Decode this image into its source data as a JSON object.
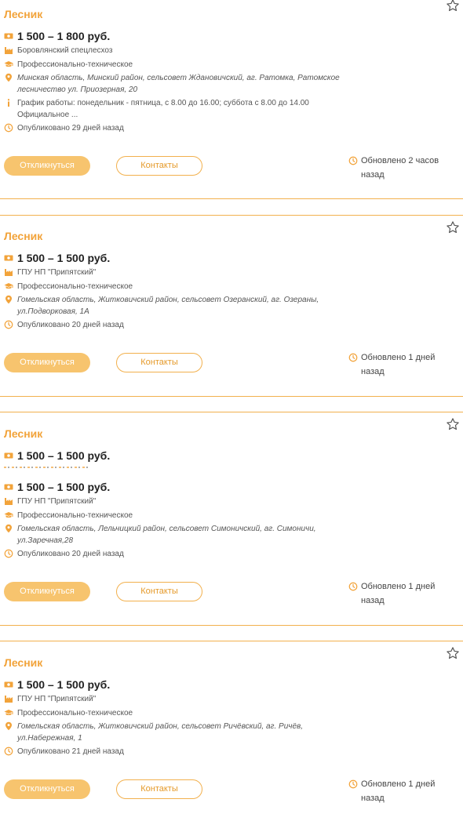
{
  "jobs": [
    {
      "title": "Лесник",
      "salary": "1 500 – 1 800 руб.",
      "employer": "Боровлянский спецлесхоз",
      "education": "Профессионально-техническое",
      "address": "Минская область, Минский район, сельсовет Ждановичский, аг. Ратомка, Ратомское\nлесничество ул. Приозерная, 20",
      "schedule": "График работы: понедельник - пятница, с 8.00 до 16.00; суббота с 8.00 до 14.00\nОфициальное ...",
      "published": "Опубликовано 29 дней назад",
      "respond_label": "Откликнуться",
      "contacts_label": "Контакты",
      "updated": "Обновлено 2 часов назад"
    },
    {
      "title": "Лесник",
      "salary": "1 500 – 1 500 руб.",
      "employer": "ГПУ НП \"Припятский\"",
      "education": "Профессионально-техническое",
      "address": "Гомельская область, Житковичский район, сельсовет Озеранский, аг. Озераны,\nул.Подворковая, 1А",
      "published": "Опубликовано 20 дней назад",
      "respond_label": "Откликнуться",
      "contacts_label": "Контакты",
      "updated": "Обновлено 1 дней назад"
    },
    {
      "title": "Лесник",
      "salary_partial": "1 500 – 1 500 руб.",
      "salary": "1 500 – 1 500 руб.",
      "employer": "ГПУ НП \"Припятский\"",
      "education": "Профессионально-техническое",
      "address": "Гомельская область, Лельчицкий район, сельсовет Симоничский, аг. Симоничи,\nул.Заречная,28",
      "published": "Опубликовано 20 дней назад",
      "respond_label": "Откликнуться",
      "contacts_label": "Контакты",
      "updated": "Обновлено 1 дней назад"
    },
    {
      "title": "Лесник",
      "salary": "1 500 – 1 500 руб.",
      "employer": "ГПУ НП \"Припятский\"",
      "education": "Профессионально-техническое",
      "address": "Гомельская область, Житковичский район, сельсовет Ричёвский, аг. Ричёв,\nул.Набережная, 1",
      "published": "Опубликовано 21 дней назад",
      "respond_label": "Откликнуться",
      "contacts_label": "Контакты",
      "updated": "Обновлено 1 дней назад"
    }
  ],
  "colors": {
    "accent": "#f2a33a",
    "button_fill": "#f7c46e",
    "divider": "#f2b04d"
  },
  "icons": [
    "star-icon",
    "money-icon",
    "factory-icon",
    "graduation-cap-icon",
    "location-pin-icon",
    "info-icon",
    "clock-icon"
  ]
}
